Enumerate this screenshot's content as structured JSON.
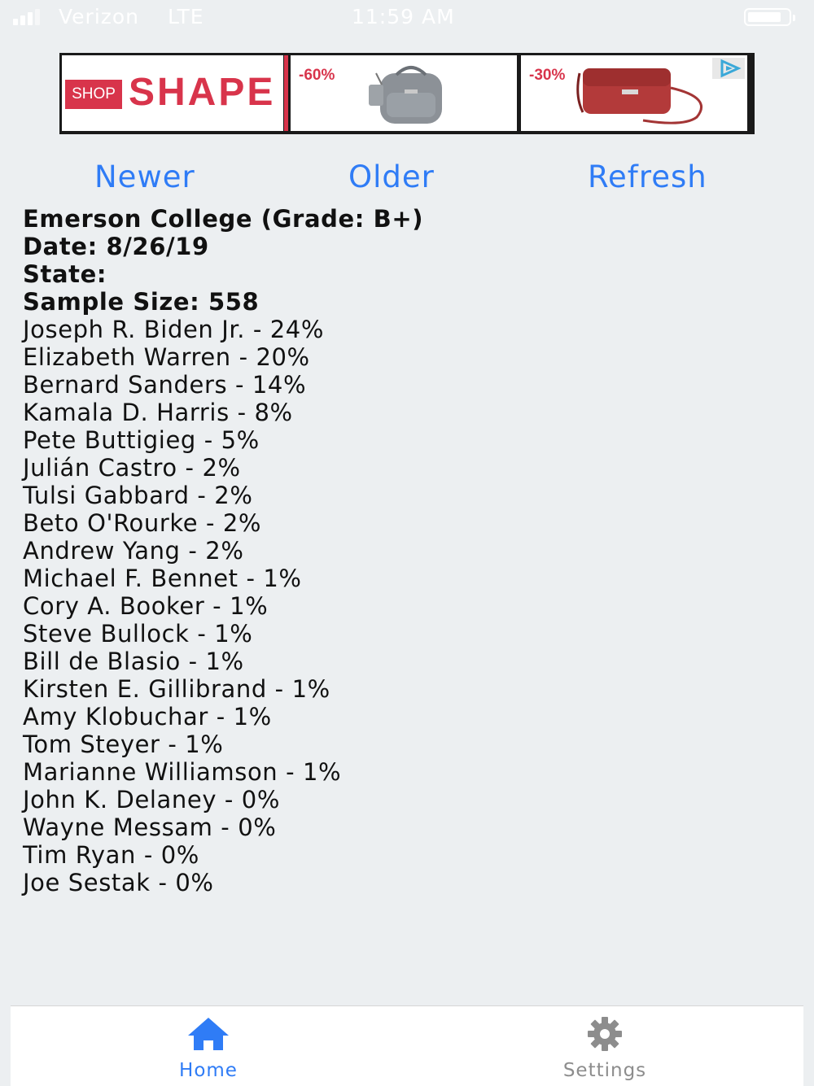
{
  "status_bar": {
    "carrier": "Verizon",
    "network": "LTE",
    "time": "11:59 AM"
  },
  "ad": {
    "shop_tag": "SHOP",
    "brand": "SHAPE",
    "item1_discount": "-60%",
    "item2_discount": "-30%",
    "brand_color": "#d8344b"
  },
  "nav": {
    "newer": "Newer",
    "older": "Older",
    "refresh": "Refresh"
  },
  "poll": {
    "pollster": "Emerson College (Grade: B+)",
    "date": "Date: 8/26/19",
    "state": "State:",
    "sample_size": "Sample Size: 558",
    "results": [
      "Joseph R. Biden Jr. - 24%",
      "Elizabeth Warren - 20%",
      "Bernard Sanders - 14%",
      "Kamala D. Harris - 8%",
      "Pete Buttigieg - 5%",
      "Julián Castro - 2%",
      "Tulsi Gabbard - 2%",
      "Beto O'Rourke - 2%",
      "Andrew Yang - 2%",
      "Michael F. Bennet - 1%",
      "Cory A. Booker - 1%",
      "Steve Bullock - 1%",
      "Bill de Blasio - 1%",
      "Kirsten E. Gillibrand - 1%",
      "Amy Klobuchar - 1%",
      "Tom Steyer - 1%",
      "Marianne Williamson - 1%",
      "John K. Delaney - 0%",
      "Wayne Messam - 0%",
      "Tim Ryan - 0%",
      "Joe Sestak - 0%"
    ]
  },
  "tabs": {
    "home": {
      "label": "Home",
      "icon": "home-icon",
      "active": true
    },
    "settings": {
      "label": "Settings",
      "icon": "gear-icon",
      "active": false
    }
  },
  "colors": {
    "accent": "#2f7cf6",
    "inactive_tab": "#8d8d8d",
    "background": "#eceff1"
  }
}
